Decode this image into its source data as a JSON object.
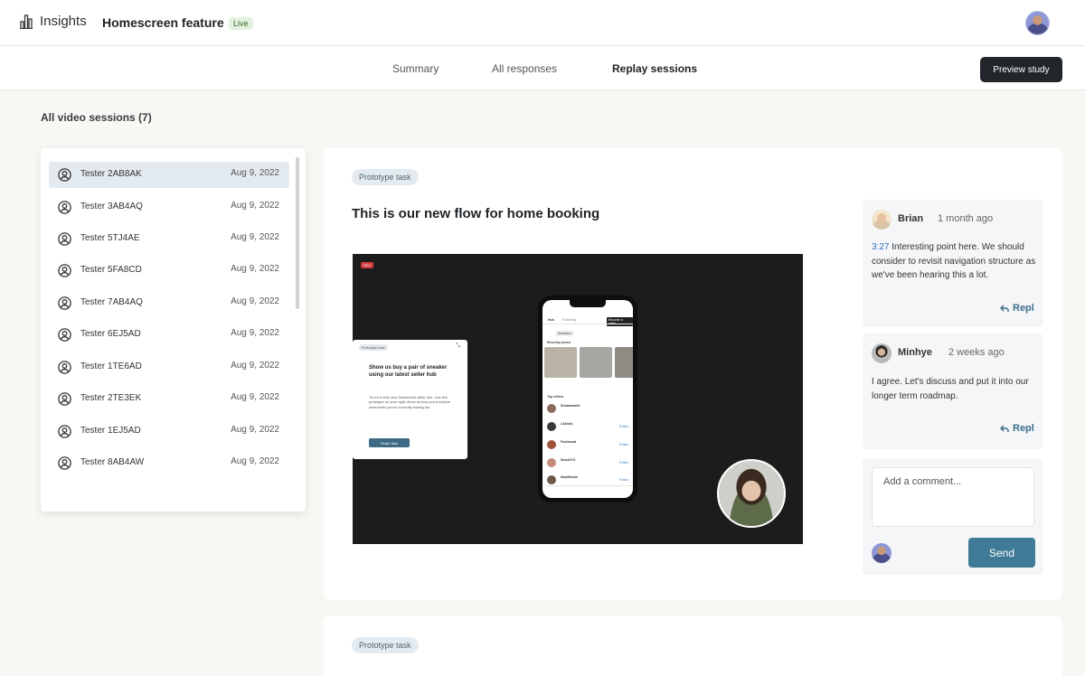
{
  "app": {
    "name": "Insights",
    "icon": "bar-chart-icon"
  },
  "page": {
    "title": "Homescreen feature",
    "status_badge": "Live"
  },
  "tabs": [
    {
      "label": "Summary",
      "active": false
    },
    {
      "label": "All responses",
      "active": false
    },
    {
      "label": "Replay sessions",
      "active": true
    }
  ],
  "header": {
    "preview_label": "Preview study"
  },
  "sessions": {
    "title": "All video sessions (7)",
    "items": [
      {
        "name": "Tester 2AB8AK",
        "date": "Aug 9, 2022",
        "selected": true
      },
      {
        "name": "Tester 3AB4AQ",
        "date": "Aug 9, 2022"
      },
      {
        "name": "Tester 5TJ4AE",
        "date": "Aug 9, 2022"
      },
      {
        "name": "Tester 5FA8CD",
        "date": "Aug 9, 2022"
      },
      {
        "name": "Tester 7AB4AQ",
        "date": "Aug 9, 2022"
      },
      {
        "name": "Tester 6EJ5AD",
        "date": "Aug 9, 2022"
      },
      {
        "name": "Tester 1TE6AD",
        "date": "Aug 9, 2022"
      },
      {
        "name": "Tester 2TE3EK",
        "date": "Aug 9, 2022"
      },
      {
        "name": "Tester 1EJ5AD",
        "date": "Aug 9, 2022"
      },
      {
        "name": "Tester 8AB4AW",
        "date": "Aug 9, 2022"
      }
    ]
  },
  "task": {
    "tag": "Prototype task",
    "title": "This is our new flow for home booking",
    "video": {
      "rec_label": "REC",
      "popup_tag": "Prototype task",
      "popup_heading": "Show us buy a pair of sneaker using our latest seller hub",
      "popup_body": "You're in this new Sneakerlist seller hub. Use live prototype on your right, show us how you'd explore inventories you're currently looking for.",
      "popup_button": "Finish task",
      "phone": {
        "tab_hub": "Hub",
        "tab_following": "Following",
        "become_seller": "Become a seller",
        "filter": "Sneakers",
        "recently_joined": "Recently joined",
        "top_sellers": "Top sellers",
        "sellers": [
          "Sneakmaster",
          "LAkicks",
          "Footbread",
          "StockXYZ",
          "DavidKicks"
        ],
        "follow": "Follow"
      }
    }
  },
  "comments": [
    {
      "author": "Brian",
      "time": "1 month ago",
      "timestamp": "3:27",
      "text": " Interesting point here. We should consider to revisit navigation structure as we've been hearing this a lot.",
      "reply_label": "Repl"
    },
    {
      "author": "Minhye",
      "time": "2 weeks ago",
      "text": "I agree. Let's discuss and put it into our longer term roadmap.",
      "reply_label": "Repl"
    }
  ],
  "compose": {
    "placeholder": "Add a comment...",
    "send_label": "Send"
  },
  "second_task": {
    "tag": "Prototype task"
  }
}
